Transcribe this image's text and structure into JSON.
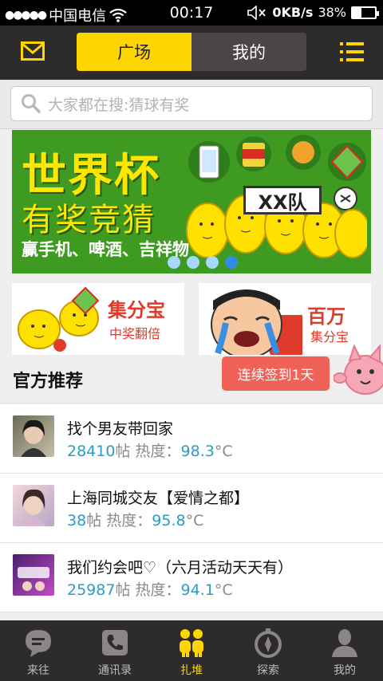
{
  "status_bar": {
    "carrier": "中国电信",
    "time": "00:17",
    "speed": "0KB/s",
    "battery": "38%",
    "battery_level": 0.38
  },
  "header": {
    "tabs": [
      {
        "label": "广场",
        "active": true
      },
      {
        "label": "我的",
        "active": false
      }
    ]
  },
  "search": {
    "placeholder": "大家都在搜:猜球有奖"
  },
  "banner": {
    "title": "世界杯",
    "subtitle": "有奖竞猜",
    "tagline": "赢手机、啤酒、吉祥物",
    "flag_text": "XX队",
    "page_count": 4,
    "active_page": 4
  },
  "tiles": [
    {
      "big": "集分宝",
      "small": "中奖翻倍"
    },
    {
      "big": "百万",
      "small": "集分宝"
    }
  ],
  "section": {
    "title": "官方推荐",
    "checkin_label": "连续签到1天"
  },
  "threads": [
    {
      "title": "找个男友带回家",
      "posts": "28410",
      "posts_suffix": "帖",
      "heat_label": "热度：",
      "heat": "98.3",
      "unit": "°C"
    },
    {
      "title": "上海同城交友【爱情之都】",
      "posts": "38",
      "posts_suffix": "帖",
      "heat_label": "热度：",
      "heat": "95.8",
      "unit": "°C"
    },
    {
      "title": "我们约会吧♡（六月活动天天有）",
      "posts": "25987",
      "posts_suffix": "帖",
      "heat_label": "热度：",
      "heat": "94.1",
      "unit": "°C"
    }
  ],
  "bottom_nav": [
    {
      "label": "来往",
      "icon": "chat-bubble-icon",
      "active": false
    },
    {
      "label": "通讯录",
      "icon": "phone-book-icon",
      "active": false
    },
    {
      "label": "扎堆",
      "icon": "group-icon",
      "active": true
    },
    {
      "label": "探索",
      "icon": "compass-icon",
      "active": false
    },
    {
      "label": "我的",
      "icon": "person-icon",
      "active": false
    }
  ],
  "colors": {
    "accent": "#ffd500",
    "dark_bar": "#2e2b2c",
    "link_blue": "#2a9cc7",
    "checkin_red": "#f06257"
  }
}
